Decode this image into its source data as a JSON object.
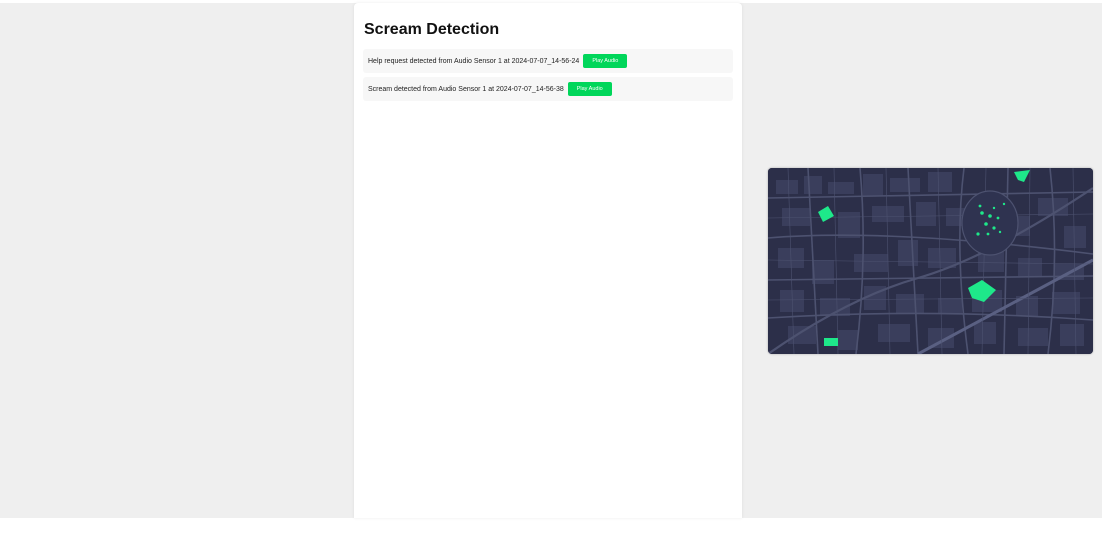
{
  "app": {
    "title": "Scream Detection"
  },
  "alerts": [
    {
      "message": "Help request detected from Audio Sensor 1 at 2024-07-07_14-56-24",
      "button_label": "Play Audio"
    },
    {
      "message": "Scream detected from Audio Sensor 1 at 2024-07-07_14-56-38",
      "button_label": "Play Audio"
    }
  ],
  "map": {
    "background_color": "#2c2f49",
    "road_color": "#4d5270",
    "block_color": "#3a3e5c",
    "park_color": "#1ee88a"
  },
  "colors": {
    "accent": "#00d65a",
    "page_background": "#efefef",
    "alert_background": "#f7f7f7"
  }
}
